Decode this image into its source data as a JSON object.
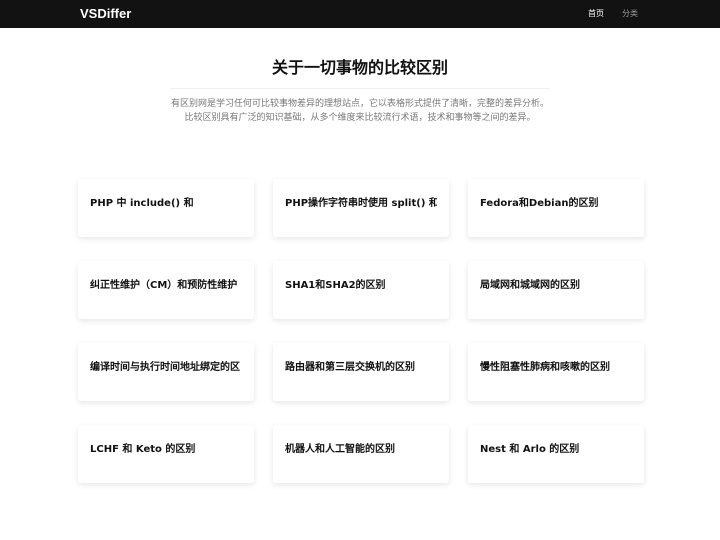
{
  "nav": {
    "brand": "VSDiffer",
    "links": [
      "首页",
      "分类"
    ]
  },
  "hero": {
    "title": "关于一切事物的比较区别",
    "description": "有区别网是学习任何可比较事物差异的理想站点，它以表格形式提供了清晰，完整的差异分析。比较区别具有广泛的知识基础，从多个维度来比较流行术语，技术和事物等之间的差异。"
  },
  "cards": [
    "PHP 中 include() 和",
    "PHP操作字符串时使用 split() 和",
    "Fedora和Debian的区别",
    "纠正性维护（CM）和预防性维护",
    "SHA1和SHA2的区别",
    "局域网和城域网的区别",
    "编译时间与执行时间地址绑定的区",
    "路由器和第三层交换机的区别",
    "慢性阻塞性肺病和咳嗽的区别",
    "LCHF 和 Keto 的区别",
    "机器人和人工智能的区别",
    "Nest 和 Arlo 的区别"
  ],
  "colors": {
    "navbar": "#121212",
    "text": "#111111",
    "muted": "#777777"
  }
}
